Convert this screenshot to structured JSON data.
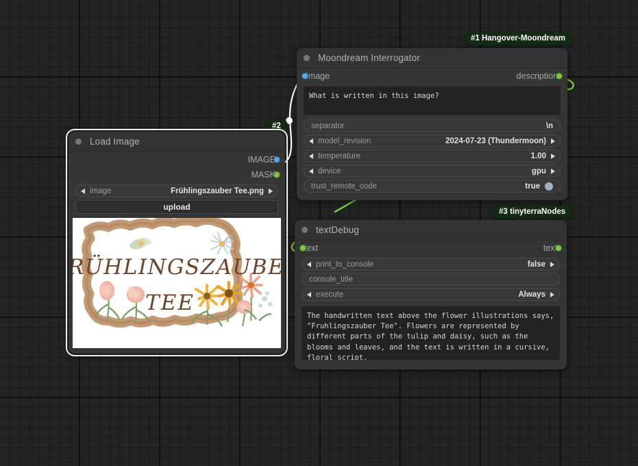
{
  "canvas": {
    "background_color": "#232323",
    "grid_color": "#1b1b1b"
  },
  "badges": {
    "moondream": "#1 Hangover-Moondream",
    "load_image": "#2",
    "text_debug": "#3 tinyterraNodes"
  },
  "nodes": {
    "moondream": {
      "title": "Moondream Interrogator",
      "input_slot": "image",
      "output_slot": "description",
      "prompt_value": "What is written in this image?",
      "widgets": [
        {
          "name": "separator",
          "value": "\\n",
          "arrows": false
        },
        {
          "name": "model_revision",
          "value": "2024-07-23 (Thundermoon)",
          "arrows": true
        },
        {
          "name": "temperature",
          "value": "1.00",
          "arrows": true
        },
        {
          "name": "device",
          "value": "gpu",
          "arrows": true
        },
        {
          "name": "trust_remote_code",
          "value": "true",
          "arrows": false,
          "toggle": true
        }
      ]
    },
    "load_image": {
      "title": "Load Image",
      "outputs": [
        "IMAGE",
        "MASK"
      ],
      "image_widget": {
        "name": "image",
        "value": "Frühlingszauber Tee.png"
      },
      "upload_label": "upload",
      "preview_text_line1": "Frühlingszauber",
      "preview_text_line2": "Tee"
    },
    "text_debug": {
      "title": "textDebug",
      "input_slot": "text",
      "output_slot": "text",
      "widgets": [
        {
          "name": "print_to_console",
          "value": "false",
          "arrows": true
        },
        {
          "name": "console_title",
          "value": "",
          "arrows": false
        },
        {
          "name": "execute",
          "value": "Always",
          "arrows": true
        }
      ],
      "output_text": "The handwritten text above the flower illustrations says, \"Fruhlingszauber Tee\". Flowers are represented by different parts of the tulip and daisy, such as the blooms and leaves, and the text is written in a cursive, floral script."
    }
  },
  "colors": {
    "image_link": "#ffffff",
    "text_link": "#7ec742",
    "image_dot": "#59a5e8",
    "mask_dot": "#7ec742",
    "badge_bg": "#142a14"
  }
}
